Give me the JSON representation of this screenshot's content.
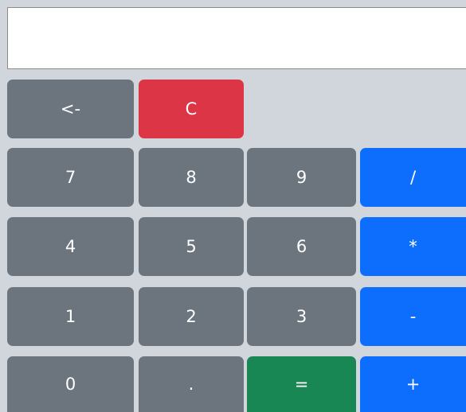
{
  "display": {
    "value": ""
  },
  "buttons": {
    "backspace": "<-",
    "clear": "C",
    "seven": "7",
    "eight": "8",
    "nine": "9",
    "divide": "/",
    "four": "4",
    "five": "5",
    "six": "6",
    "multiply": "*",
    "one": "1",
    "two": "2",
    "three": "3",
    "subtract": "-",
    "zero": "0",
    "decimal": ".",
    "equals": "=",
    "add": "+"
  },
  "colors": {
    "background": "#d0d6dc",
    "secondary": "#6c757d",
    "danger": "#dc3545",
    "primary": "#0d6efd",
    "success": "#198754"
  }
}
